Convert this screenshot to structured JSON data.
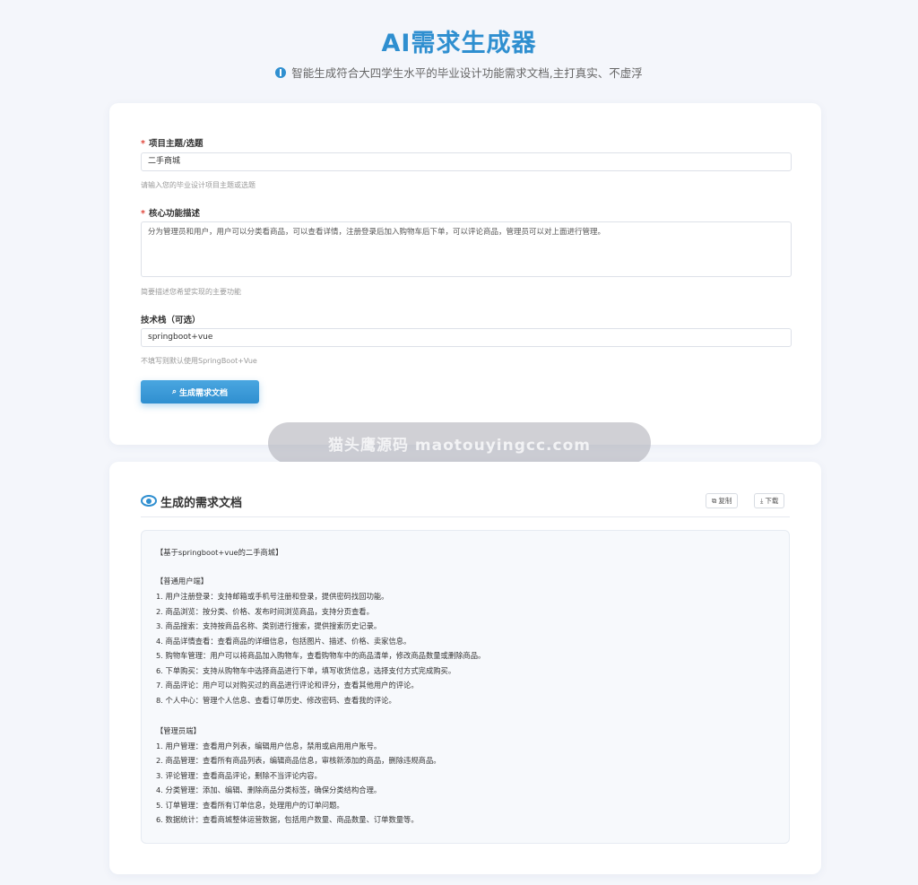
{
  "header": {
    "title": "AI需求生成器",
    "subtitle": "智能生成符合大四学生水平的毕业设计功能需求文档,主打真实、不虚浮"
  },
  "form": {
    "topic": {
      "label": "项目主题/选题",
      "value": "二手商城",
      "hint": "请输入您的毕业设计项目主题或选题"
    },
    "features": {
      "label": "核心功能描述",
      "value": "分为管理员和用户，用户可以分类看商品，可以查看详情，注册登录后加入购物车后下单，可以评论商品，管理员可以对上面进行管理。",
      "hint": "简要描述您希望实现的主要功能"
    },
    "stack": {
      "label": "技术栈（可选）",
      "value": "springboot+vue",
      "hint": "不填写则默认使用SpringBoot+Vue"
    },
    "generate_label": "生成需求文档"
  },
  "result": {
    "title": "生成的需求文档",
    "copy_label": "复制",
    "download_label": "下载",
    "doc_title": "【基于springboot+vue的二手商城】",
    "user_section": "【普通用户端】",
    "user_items": [
      "1. 用户注册登录：支持邮箱或手机号注册和登录，提供密码找回功能。",
      "2. 商品浏览：按分类、价格、发布时间浏览商品，支持分页查看。",
      "3. 商品搜索：支持按商品名称、类别进行搜索，提供搜索历史记录。",
      "4. 商品详情查看：查看商品的详细信息，包括图片、描述、价格、卖家信息。",
      "5. 购物车管理：用户可以将商品加入购物车，查看购物车中的商品清单，修改商品数量或删除商品。",
      "6. 下单购买：支持从购物车中选择商品进行下单，填写收货信息，选择支付方式完成购买。",
      "7. 商品评论：用户可以对购买过的商品进行评论和评分，查看其他用户的评论。",
      "8. 个人中心：管理个人信息、查看订单历史、修改密码、查看我的评论。"
    ],
    "admin_section": "【管理员端】",
    "admin_items": [
      "1. 用户管理：查看用户列表，编辑用户信息，禁用或启用用户账号。",
      "2. 商品管理：查看所有商品列表，编辑商品信息，审核新添加的商品，删除违规商品。",
      "3. 评论管理：查看商品评论，删除不当评论内容。",
      "4. 分类管理：添加、编辑、删除商品分类标签，确保分类结构合理。",
      "5. 订单管理：查看所有订单信息，处理用户的订单问题。",
      "6. 数据统计：查看商城整体运营数据，包括用户数量、商品数量、订单数量等。"
    ]
  },
  "watermark": "猫头鹰源码 maotouyingcc.com"
}
